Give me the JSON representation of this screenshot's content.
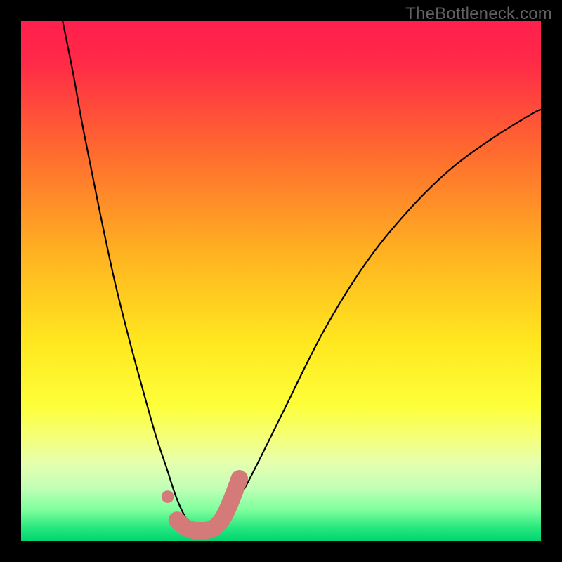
{
  "watermark": {
    "text": "TheBottleneck.com"
  },
  "chart_data": {
    "type": "line",
    "title": "",
    "xlabel": "",
    "ylabel": "",
    "ylim": [
      0,
      100
    ],
    "xlim": [
      0,
      100
    ],
    "gradient_stops": [
      {
        "offset": 0.0,
        "color": "#ff1f4d"
      },
      {
        "offset": 0.08,
        "color": "#ff2a47"
      },
      {
        "offset": 0.25,
        "color": "#ff6a2f"
      },
      {
        "offset": 0.45,
        "color": "#ffb321"
      },
      {
        "offset": 0.62,
        "color": "#ffe81f"
      },
      {
        "offset": 0.74,
        "color": "#fdff3a"
      },
      {
        "offset": 0.8,
        "color": "#f5ff77"
      },
      {
        "offset": 0.85,
        "color": "#e6ffaf"
      },
      {
        "offset": 0.9,
        "color": "#bfffb6"
      },
      {
        "offset": 0.94,
        "color": "#7fff9d"
      },
      {
        "offset": 0.975,
        "color": "#27e77e"
      },
      {
        "offset": 1.0,
        "color": "#00d572"
      }
    ],
    "series": [
      {
        "name": "bottleneck-curve",
        "x": [
          8,
          10,
          12,
          15,
          18,
          21,
          24,
          26,
          28,
          30,
          32,
          34,
          36,
          38,
          40,
          44,
          50,
          58,
          66,
          74,
          82,
          90,
          98,
          100
        ],
        "y": [
          100,
          90,
          79,
          64,
          50,
          38,
          27,
          20,
          14,
          8,
          4,
          2.5,
          2,
          2.5,
          5,
          12,
          24,
          40,
          53,
          63,
          71,
          77,
          82,
          83
        ]
      }
    ],
    "trough_marker": {
      "name": "optimal-range",
      "color": "#d47a78",
      "dot": {
        "x": 28.2,
        "y": 8.5,
        "r": 1.2
      },
      "stroke_width": 3.3,
      "x": [
        30.0,
        31.5,
        33.0,
        34.5,
        36.0,
        37.5,
        39.0,
        40.5,
        42.0
      ],
      "y": [
        4.0,
        2.7,
        2.1,
        2.0,
        2.1,
        2.8,
        4.7,
        8.0,
        12.0
      ]
    }
  }
}
